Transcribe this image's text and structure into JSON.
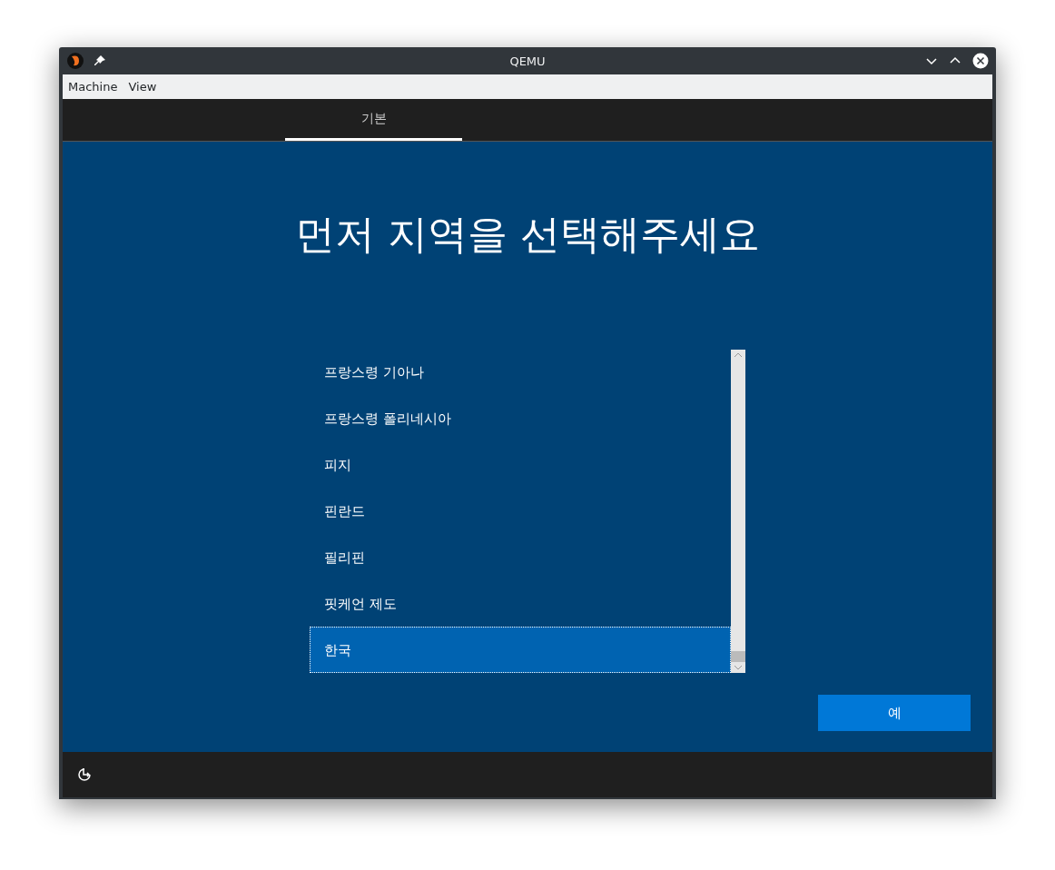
{
  "window": {
    "title": "QEMU"
  },
  "menu": [
    "Machine",
    "View"
  ],
  "tabs": [
    {
      "label": "기본",
      "selected": true
    }
  ],
  "heading": "먼저 지역을 선택해주세요",
  "regions": [
    {
      "label": "프랑스령 기아나",
      "selected": false
    },
    {
      "label": "프랑스령 폴리네시아",
      "selected": false
    },
    {
      "label": "피지",
      "selected": false
    },
    {
      "label": "핀란드",
      "selected": false
    },
    {
      "label": "필리핀",
      "selected": false
    },
    {
      "label": "핏케언 제도",
      "selected": false
    },
    {
      "label": "한국",
      "selected": true
    }
  ],
  "next_button": "예"
}
